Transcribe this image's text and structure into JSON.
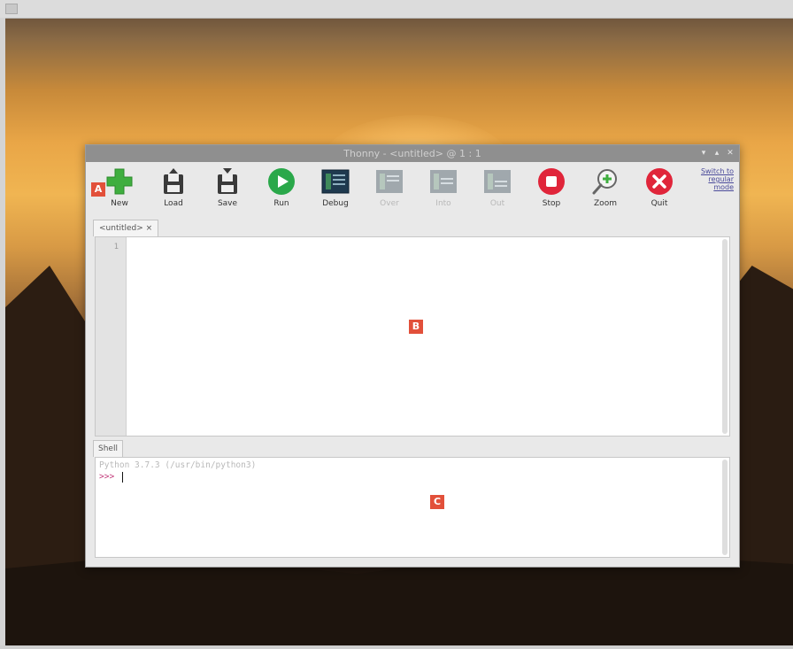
{
  "window": {
    "title": "Thonny  -  <untitled>  @  1 : 1",
    "controls": [
      "minimize-icon",
      "maximize-icon",
      "close-icon"
    ]
  },
  "toolbar": {
    "buttons": [
      {
        "label": "New",
        "icon": "new-icon",
        "enabled": true
      },
      {
        "label": "Load",
        "icon": "load-icon",
        "enabled": true
      },
      {
        "label": "Save",
        "icon": "save-icon",
        "enabled": true
      },
      {
        "label": "Run",
        "icon": "run-icon",
        "enabled": true
      },
      {
        "label": "Debug",
        "icon": "debug-icon",
        "enabled": true
      },
      {
        "label": "Over",
        "icon": "step-over-icon",
        "enabled": false
      },
      {
        "label": "Into",
        "icon": "step-into-icon",
        "enabled": false
      },
      {
        "label": "Out",
        "icon": "step-out-icon",
        "enabled": false
      },
      {
        "label": "Stop",
        "icon": "stop-icon",
        "enabled": true
      },
      {
        "label": "Zoom",
        "icon": "zoom-icon",
        "enabled": true
      },
      {
        "label": "Quit",
        "icon": "quit-icon",
        "enabled": true
      }
    ],
    "switch_mode_link": "Switch to regular mode"
  },
  "editor": {
    "tab_label": "<untitled> ×",
    "line_number": "1"
  },
  "shell": {
    "tab_label": "Shell",
    "banner": "Python 3.7.3 (/usr/bin/python3)",
    "prompt": ">>>"
  },
  "annotations": [
    "A",
    "B",
    "C"
  ],
  "colors": {
    "accent_badge": "#e2503a",
    "new_green": "#3fae3f",
    "run_green": "#2aa84a",
    "stop_red": "#e0253a",
    "quit_red": "#e0253a",
    "prompt_magenta": "#c23a7a"
  }
}
